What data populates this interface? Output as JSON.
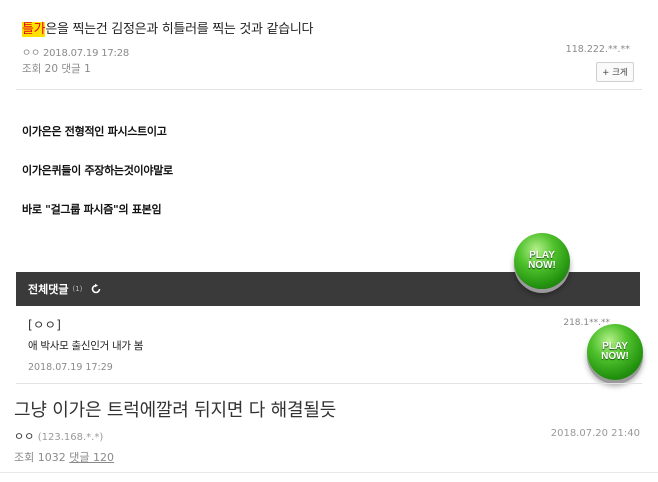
{
  "post1": {
    "title_highlight": "틀가",
    "title_rest": "은을 찍는건 김정은과 히틀러를 찍는 것과 같습니다",
    "author": "ㅇㅇ",
    "date": "2018.07.19 17:28",
    "ip": "118.222.**.**",
    "views_label": "조회",
    "views": "20",
    "comments_label": "댓글",
    "comments": "1",
    "zoom_button": "+ 크게",
    "body": [
      "이가은은 전형적인 파시스트이고",
      "이가은퀴들이 주장하는것이야말로",
      "바로 \"걸그룹 파시즘\"의 표본임"
    ]
  },
  "comments_bar": {
    "label": "전체댓글",
    "count": "(1)"
  },
  "comment": {
    "author": "[ㅇㅇ]",
    "ip": "218.1**.**",
    "text": "애 박사모 출신인거 내가 봄",
    "date": "2018.07.19 17:29"
  },
  "post2": {
    "title": "그냥 이가은 트럭에깔려 뒤지면 다 해결될듯",
    "author": "ㅇㅇ",
    "ip": "(123.168.*.*)",
    "date": "2018.07.20 21:40",
    "views_label": "조회",
    "views": "1032",
    "comments_link": "댓글 120"
  },
  "ads": {
    "play_now": "PLAY\nNOW!"
  }
}
